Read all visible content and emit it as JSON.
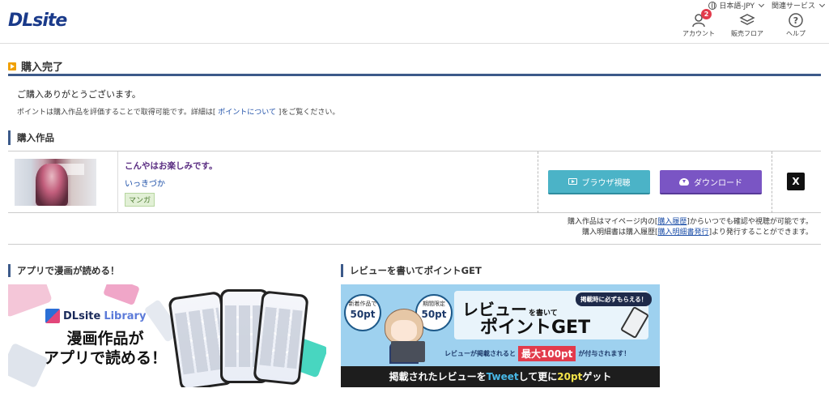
{
  "header": {
    "logo": "DLsite",
    "language": "日本語-JPY",
    "related_services": "関連サービス",
    "nav": [
      {
        "label": "アカウント",
        "badge": "2",
        "icon": "account-icon"
      },
      {
        "label": "販売フロア",
        "icon": "layers-icon"
      },
      {
        "label": "ヘルプ",
        "icon": "help-icon"
      }
    ]
  },
  "page_title": "購入完了",
  "thanks": "ご購入ありがとうございます。",
  "points_note": {
    "prefix": "ポイントは購入作品を評価することで取得可能です。詳細は[",
    "link": "ポイントについて",
    "suffix": "]をご覧ください。"
  },
  "purchased_section_title": "購入作品",
  "purchased": {
    "title": "こんやはお楽しみです。",
    "author": "いっきづか",
    "tag": "マンガ",
    "browser_button": "ブラウザ視聴",
    "download_button": "ダウンロード",
    "share": "X"
  },
  "history_note": {
    "line1_prefix": "購入作品はマイページ内の[",
    "line1_link": "購入履歴",
    "line1_suffix": "]からいつでも確認や視聴が可能です。",
    "line2_prefix": "購入明細書は購入履歴[",
    "line2_link": "購入明細書発行",
    "line2_suffix": "]より発行することができます。"
  },
  "app_section_title": "アプリで漫画が読める！",
  "review_section_title": "レビューを書いてポイントGET",
  "app_banner": {
    "logo_main": "DLsite",
    "logo_sub": "Library",
    "line1": "漫画作品が",
    "line2": "アプリで読める！"
  },
  "review_banner": {
    "bubble1_top": "新着作品で",
    "bubble1_value": "50pt",
    "bubble2_top": "期間限定",
    "bubble2_value": "50pt",
    "tag": "掲載時に必ずもらえる！",
    "title1": "レビュー",
    "title1_small": "を書いて",
    "title2": "ポイントGET",
    "desc_prefix": "レビューが掲載されると",
    "desc_highlight": "最大100pt",
    "desc_suffix": "が付与されます！",
    "bottom_prefix": "掲載されたレビューを",
    "bottom_tweet": "Tweet",
    "bottom_mid": "して更に",
    "bottom_value": "20pt",
    "bottom_suffix": "ゲット"
  },
  "colors": {
    "accent": "#3c5a8a",
    "browser_button": "#4bb3c7",
    "download_button": "#7a55c4",
    "badge": "#e23b4c"
  }
}
